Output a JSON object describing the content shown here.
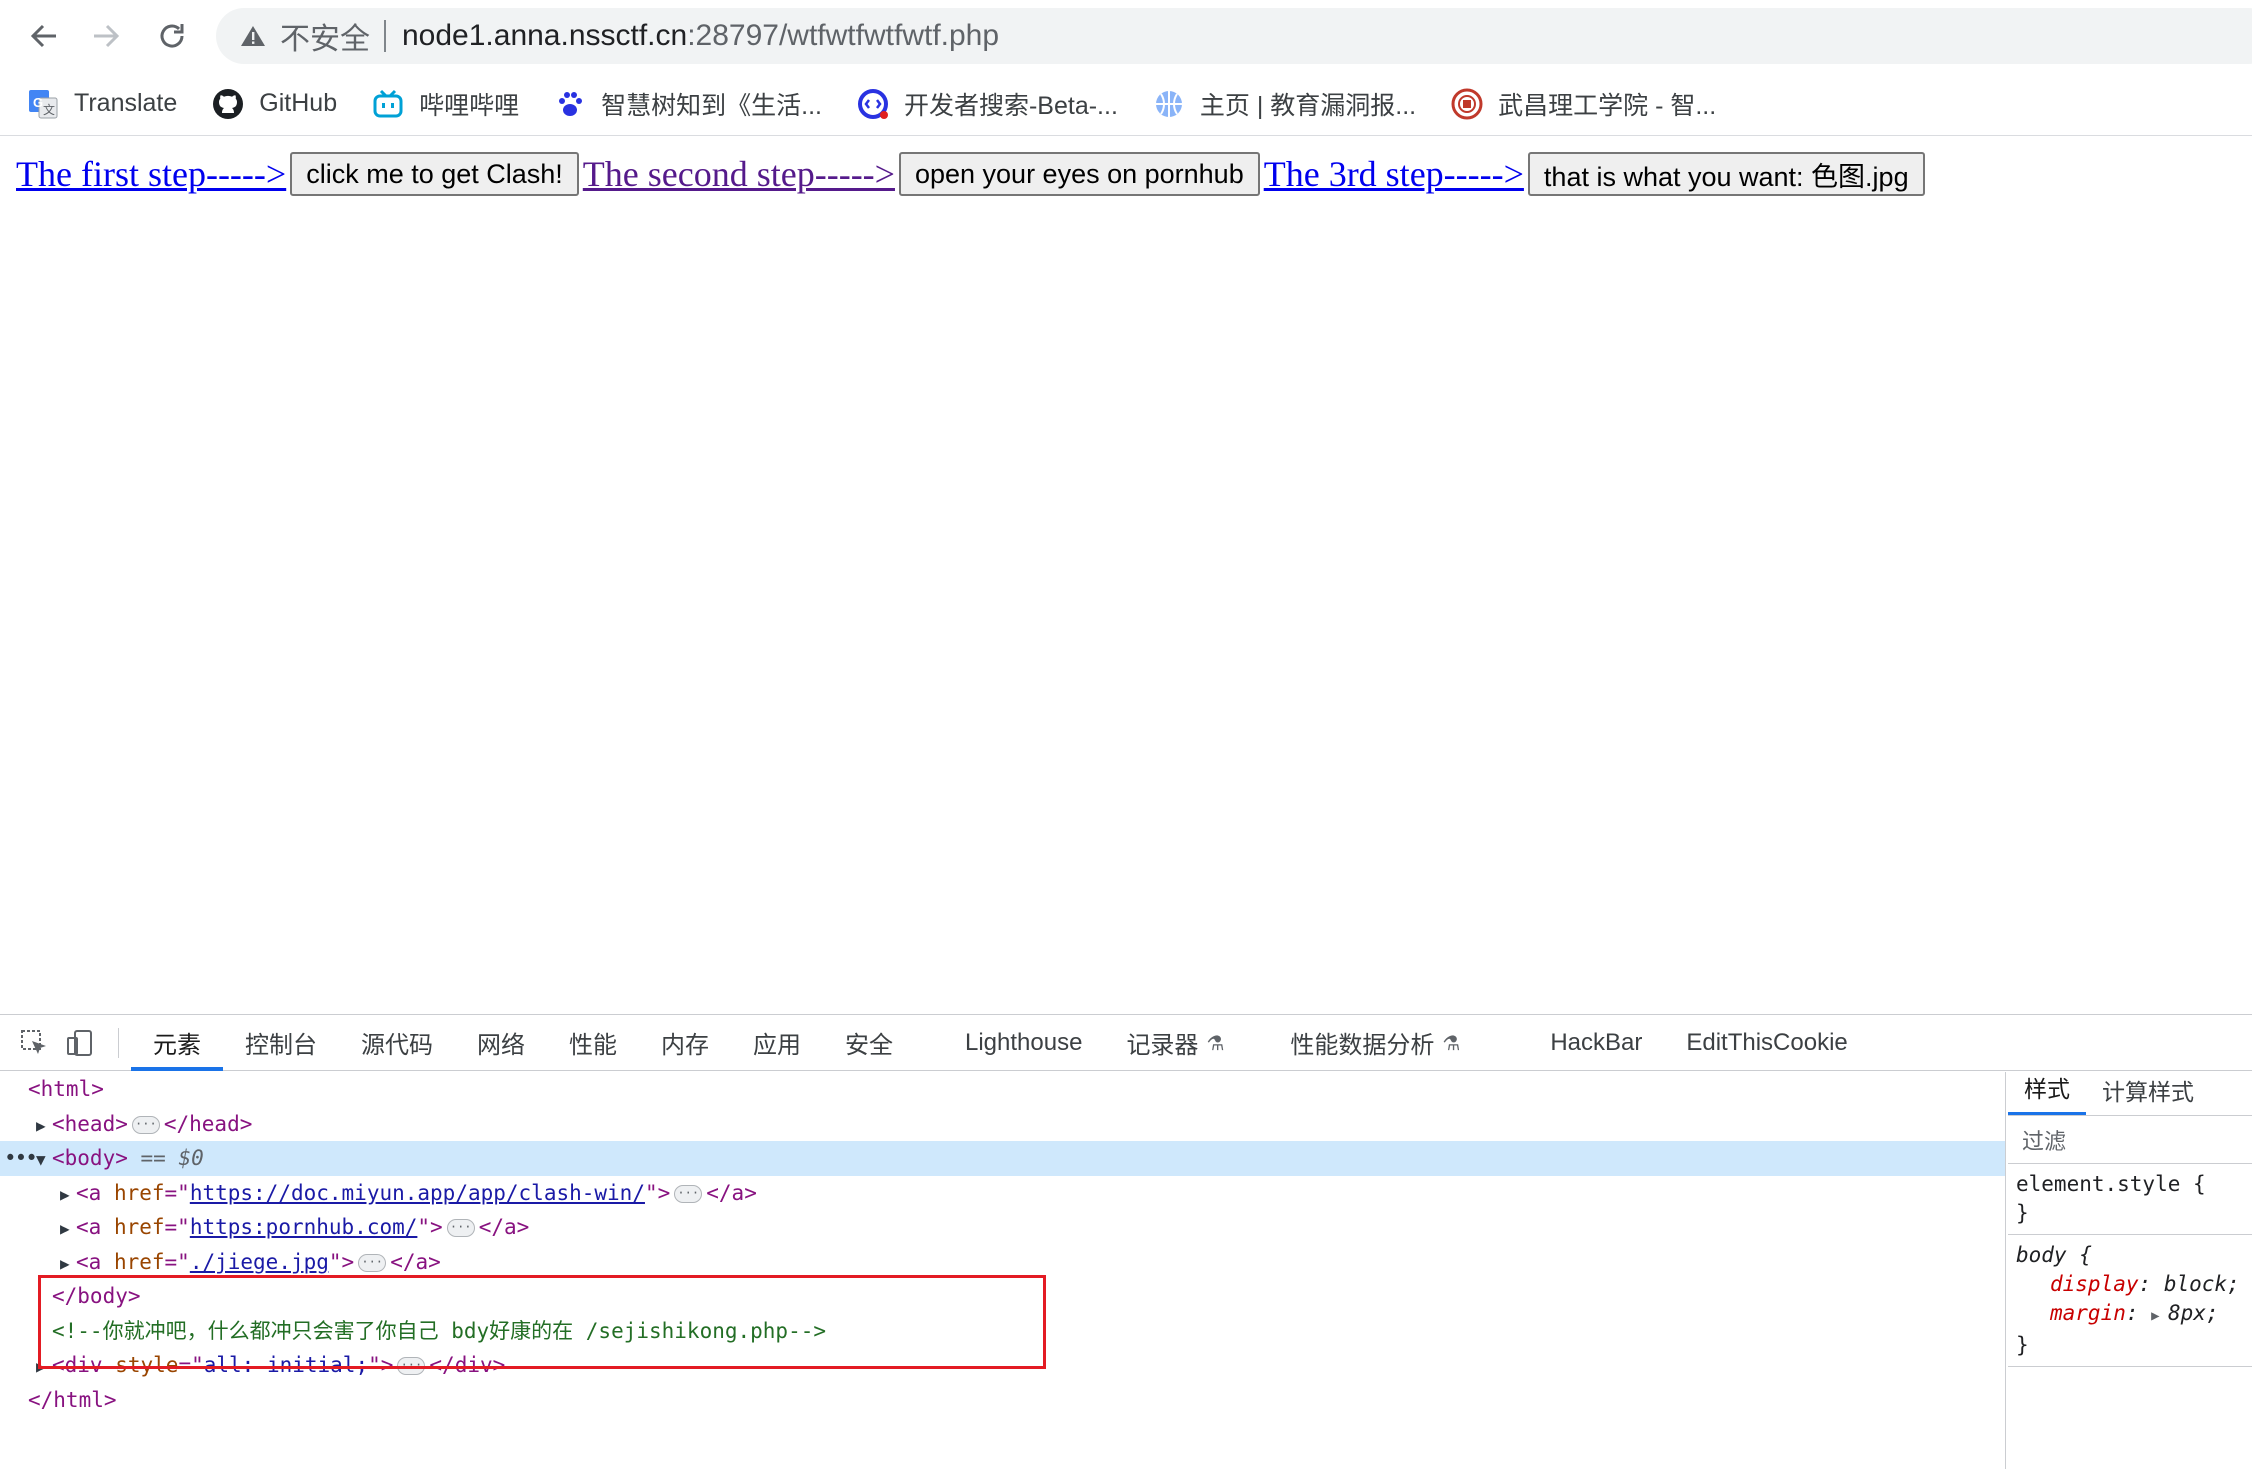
{
  "browser": {
    "security_label": "不安全",
    "url_host": "node1.anna.nssctf.cn",
    "url_rest": ":28797/wtfwtfwtfwtf.php",
    "bookmarks": [
      {
        "label": "Translate",
        "icon": "google-translate-icon"
      },
      {
        "label": "GitHub",
        "icon": "github-icon"
      },
      {
        "label": "哔哩哔哩",
        "icon": "bilibili-icon"
      },
      {
        "label": "智慧树知到《生活...",
        "icon": "paw-icon"
      },
      {
        "label": "开发者搜索-Beta-...",
        "icon": "dev-search-icon"
      },
      {
        "label": "主页 | 教育漏洞报...",
        "icon": "globe-icon"
      },
      {
        "label": "武昌理工学院 - 智...",
        "icon": "school-seal-icon"
      }
    ]
  },
  "page": {
    "step1_link": "The first step----->",
    "step1_button": "click me to get Clash!",
    "step2_link": "The second step----->",
    "step2_button": "open your eyes on pornhub",
    "step3_link": "The 3rd step----->",
    "step3_button": "that is what you want: 色图.jpg"
  },
  "devtools": {
    "tabs": [
      "元素",
      "控制台",
      "源代码",
      "网络",
      "性能",
      "内存",
      "应用",
      "安全",
      "Lighthouse",
      "记录器",
      "性能数据分析",
      "HackBar",
      "EditThisCookie"
    ],
    "dom": {
      "html_open": "<html>",
      "head_open": "<head>",
      "head_close": "</head>",
      "body_open": "<body>",
      "body_selected": "== $0",
      "a1_href": "https://doc.miyun.app/app/clash-win/",
      "a2_href": "https:pornhub.com/",
      "a3_href": "./jiege.jpg",
      "body_close": "</body>",
      "comment": "<!--你就冲吧，什么都冲只会害了你自己 bdy好康的在 /sejishikong.php-->",
      "div_style": "all: initial;",
      "html_close": "</html>"
    },
    "styles": {
      "tabs": [
        "样式",
        "计算样式"
      ],
      "filter_placeholder": "过滤",
      "element_style": "element.style {",
      "close_brace": "}",
      "body_selector": "body {",
      "display_prop": "display",
      "display_val": "block;",
      "margin_prop": "margin",
      "margin_val": "8px;"
    }
  }
}
